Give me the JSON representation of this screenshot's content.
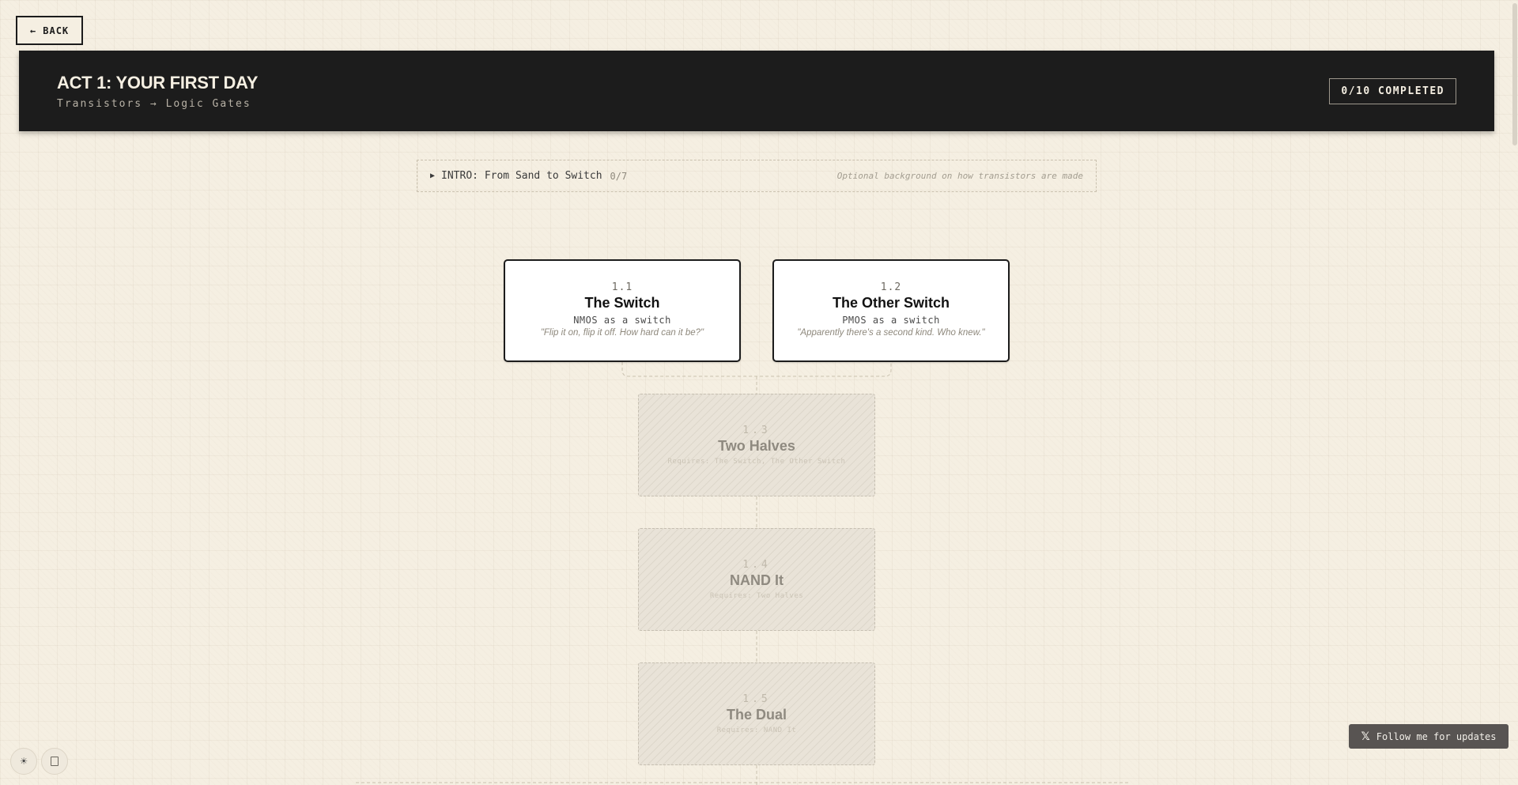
{
  "back_button": {
    "label": "← BACK"
  },
  "header": {
    "title": "ACT 1: YOUR FIRST DAY",
    "subtitle": "Transistors → Logic Gates",
    "progress": "0/10 COMPLETED"
  },
  "intro": {
    "label": "INTRO: From Sand to Switch",
    "count": "0/7",
    "description": "Optional background on how transistors are made"
  },
  "levels": [
    {
      "number": "1.1",
      "title": "The Switch",
      "subtitle": "NMOS as a switch",
      "quote": "\"Flip it on, flip it off. How hard can it be?\"",
      "status": "available"
    },
    {
      "number": "1.2",
      "title": "The Other Switch",
      "subtitle": "PMOS as a switch",
      "quote": "\"Apparently there's a second kind. Who knew.\"",
      "status": "available"
    },
    {
      "number": "1.3",
      "title": "Two Halves",
      "requires": "Requires: The Switch, The Other Switch",
      "status": "locked"
    },
    {
      "number": "1.4",
      "title": "NAND It",
      "requires": "Requires: Two Halves",
      "status": "locked"
    },
    {
      "number": "1.5",
      "title": "The Dual",
      "requires": "Requires: NAND It",
      "status": "locked"
    }
  ],
  "footer": {
    "theme_icon": "sun-icon",
    "fullscreen_icon": "square-icon",
    "follow_icon": "x-logo-icon",
    "follow_label": "Follow me for updates"
  }
}
